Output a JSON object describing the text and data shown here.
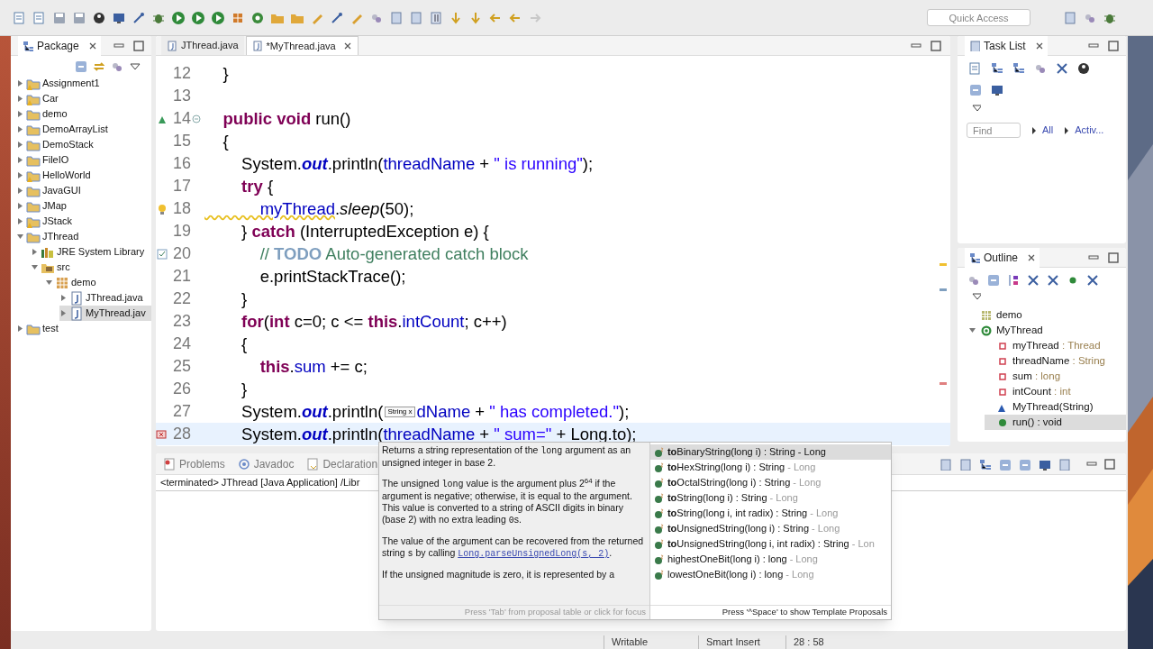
{
  "toolbar": {
    "quick_access": {
      "placeholder": "Quick Access"
    }
  },
  "package_explorer": {
    "title": "Package",
    "items": [
      {
        "label": "Assignment1",
        "kind": "project",
        "warning": true,
        "expanded": false,
        "selected": false
      },
      {
        "label": "Car",
        "kind": "project",
        "warning": true,
        "expanded": false,
        "selected": false
      },
      {
        "label": "demo",
        "kind": "project",
        "warning": false,
        "expanded": false,
        "selected": false
      },
      {
        "label": "DemoArrayList",
        "kind": "project",
        "warning": false,
        "expanded": false,
        "selected": false
      },
      {
        "label": "DemoStack",
        "kind": "project",
        "warning": false,
        "expanded": false,
        "selected": false
      },
      {
        "label": "FileIO",
        "kind": "project",
        "warning": false,
        "expanded": false,
        "selected": false
      },
      {
        "label": "HelloWorld",
        "kind": "project",
        "warning": true,
        "expanded": false,
        "selected": false
      },
      {
        "label": "JavaGUI",
        "kind": "project",
        "warning": false,
        "expanded": false,
        "selected": false
      },
      {
        "label": "JMap",
        "kind": "project",
        "warning": false,
        "expanded": false,
        "selected": false
      },
      {
        "label": "JStack",
        "kind": "project",
        "warning": true,
        "expanded": false,
        "selected": false
      },
      {
        "label": "JThread",
        "kind": "project",
        "warning": false,
        "expanded": true,
        "selected": false,
        "children": [
          {
            "label": "JRE System Library",
            "kind": "library",
            "warning": false,
            "expanded": false,
            "selected": false
          },
          {
            "label": "src",
            "kind": "source_folder",
            "warning": false,
            "expanded": true,
            "selected": false,
            "children": [
              {
                "label": "demo",
                "kind": "package",
                "warning": false,
                "expanded": true,
                "selected": false,
                "children": [
                  {
                    "label": "JThread.java",
                    "kind": "java_file",
                    "warning": false,
                    "expanded": false,
                    "selected": false
                  },
                  {
                    "label": "MyThread.jav",
                    "kind": "java_file",
                    "warning": false,
                    "expanded": false,
                    "selected": true
                  }
                ]
              }
            ]
          }
        ]
      },
      {
        "label": "test",
        "kind": "project",
        "warning": false,
        "expanded": false,
        "selected": false
      }
    ]
  },
  "editor": {
    "tabs": [
      {
        "label": "JThread.java",
        "selected": false
      },
      {
        "label": "*MyThread.java",
        "selected": true
      }
    ],
    "lines": [
      {
        "number": "12",
        "kind": "plain",
        "current": false,
        "tokens": [
          {
            "text": "    }",
            "kind": "plain"
          }
        ]
      },
      {
        "number": "13",
        "kind": "plain",
        "current": false
      },
      {
        "number": "14",
        "kind": "override",
        "current": false,
        "tokens": [
          {
            "text": "    public void",
            "kind": "keyword"
          },
          {
            "text": " run()",
            "kind": "plain"
          }
        ]
      },
      {
        "number": "15",
        "kind": "plain",
        "current": false,
        "tokens": [
          {
            "text": "    {",
            "kind": "plain"
          }
        ]
      },
      {
        "number": "16",
        "kind": "plain",
        "current": false,
        "tokens": [
          {
            "text": "        System.",
            "kind": "plain"
          },
          {
            "text": "out",
            "kind": "static_field"
          },
          {
            "text": ".println(",
            "kind": "plain"
          },
          {
            "text": "threadName",
            "kind": "field"
          },
          {
            "text": " + ",
            "kind": "plain"
          },
          {
            "text": "\" is running\"",
            "kind": "string"
          },
          {
            "text": ");",
            "kind": "plain"
          }
        ]
      },
      {
        "number": "17",
        "kind": "plain",
        "current": false,
        "tokens": [
          {
            "text": "        try",
            "kind": "keyword"
          },
          {
            "text": " {",
            "kind": "plain"
          }
        ]
      },
      {
        "number": "18",
        "kind": "warning",
        "current": false,
        "tokens": [
          {
            "text": "            myThread",
            "kind": "field_warning"
          },
          {
            "text": ".",
            "kind": "plain"
          },
          {
            "text": "sleep",
            "kind": "static_method"
          },
          {
            "text": "(50);",
            "kind": "plain"
          }
        ]
      },
      {
        "number": "19",
        "kind": "plain",
        "current": false,
        "tokens": [
          {
            "text": "        } ",
            "kind": "plain"
          },
          {
            "text": "catch",
            "kind": "keyword"
          },
          {
            "text": " (InterruptedException e) {",
            "kind": "plain"
          }
        ]
      },
      {
        "number": "20",
        "kind": "task",
        "current": false,
        "tokens": [
          {
            "text": "            // ",
            "kind": "comment"
          },
          {
            "text": "TODO",
            "kind": "task_tag"
          },
          {
            "text": " Auto-generated catch block",
            "kind": "comment"
          }
        ]
      },
      {
        "number": "21",
        "kind": "plain",
        "current": false,
        "tokens": [
          {
            "text": "            e.printStackTrace();",
            "kind": "plain"
          }
        ]
      },
      {
        "number": "22",
        "kind": "plain",
        "current": false,
        "tokens": [
          {
            "text": "        }",
            "kind": "plain"
          }
        ]
      },
      {
        "number": "23",
        "kind": "plain",
        "current": false,
        "tokens": [
          {
            "text": "        for",
            "kind": "keyword"
          },
          {
            "text": "(",
            "kind": "plain"
          },
          {
            "text": "int",
            "kind": "keyword"
          },
          {
            "text": " c=0; c <= ",
            "kind": "plain"
          },
          {
            "text": "this",
            "kind": "keyword"
          },
          {
            "text": ".",
            "kind": "plain"
          },
          {
            "text": "intCount",
            "kind": "field"
          },
          {
            "text": "; c++)",
            "kind": "plain"
          }
        ]
      },
      {
        "number": "24",
        "kind": "plain",
        "current": false,
        "tokens": [
          {
            "text": "        {",
            "kind": "plain"
          }
        ]
      },
      {
        "number": "25",
        "kind": "plain",
        "current": false,
        "tokens": [
          {
            "text": "            this",
            "kind": "keyword"
          },
          {
            "text": ".",
            "kind": "plain"
          },
          {
            "text": "sum",
            "kind": "field"
          },
          {
            "text": " += c;",
            "kind": "plain"
          }
        ]
      },
      {
        "number": "26",
        "kind": "plain",
        "current": false,
        "tokens": [
          {
            "text": "        }",
            "kind": "plain"
          }
        ]
      },
      {
        "number": "27",
        "kind": "plain",
        "current": false,
        "tokens": [
          {
            "text": "        System.",
            "kind": "plain"
          },
          {
            "text": "out",
            "kind": "static_field"
          },
          {
            "text": ".println(",
            "kind": "plain"
          },
          {
            "text": "String x",
            "kind": "hint"
          },
          {
            "text": "dName",
            "kind": "field"
          },
          {
            "text": " + ",
            "kind": "plain"
          },
          {
            "text": "\" has completed.\"",
            "kind": "string"
          },
          {
            "text": ");",
            "kind": "plain"
          }
        ]
      },
      {
        "number": "28",
        "kind": "error",
        "current": true,
        "tokens": [
          {
            "text": "        System.",
            "kind": "plain"
          },
          {
            "text": "out",
            "kind": "static_field"
          },
          {
            "text": ".println(",
            "kind": "plain"
          },
          {
            "text": "threadName",
            "kind": "field"
          },
          {
            "text": " + ",
            "kind": "plain"
          },
          {
            "text": "\" sum=\"",
            "kind": "string"
          },
          {
            "text": " + Long.to);",
            "kind": "plain"
          }
        ]
      }
    ]
  },
  "completion": {
    "doc": [
      [
        {
          "text": "Returns a string representation of the ",
          "kind": "text"
        },
        {
          "text": "long",
          "kind": "code"
        },
        {
          "text": " argument as an unsigned integer in base 2.",
          "kind": "text"
        }
      ],
      [
        {
          "text": "The unsigned ",
          "kind": "text"
        },
        {
          "text": "long",
          "kind": "code"
        },
        {
          "text": " value is the argument plus 2$^{64}$ if the argument is negative; otherwise, it is equal to the argument. This value is converted to a string of ASCII digits in binary (base 2) with no extra leading ",
          "kind": "text"
        },
        {
          "text": "0",
          "kind": "code"
        },
        {
          "text": "s.",
          "kind": "text"
        }
      ],
      [
        {
          "text": "The value of the argument can be recovered from the returned string ",
          "kind": "text"
        },
        {
          "text": "s",
          "kind": "code"
        },
        {
          "text": " by calling ",
          "kind": "text"
        },
        {
          "text": "Long.parseUnsignedLong(s, 2)",
          "kind": "link"
        },
        {
          "text": ".",
          "kind": "text"
        }
      ],
      [
        {
          "text": "If the unsigned magnitude is zero, it is represented by a",
          "kind": "text"
        }
      ]
    ],
    "doc_footer": "Press 'Tab' from proposal table or click for focus",
    "proposals": [
      {
        "label": "**to**BinaryString(long i) : String",
        "qualifier": "- Long",
        "selected": true
      },
      {
        "label": "**to**HexString(long i) : String",
        "qualifier": "- Long",
        "selected": false
      },
      {
        "label": "**to**OctalString(long i) : String",
        "qualifier": "- Long",
        "selected": false
      },
      {
        "label": "**to**String(long i) : String",
        "qualifier": "- Long",
        "selected": false
      },
      {
        "label": "**to**String(long i, int radix) : String",
        "qualifier": "- Long",
        "selected": false
      },
      {
        "label": "**to**UnsignedString(long i) : String",
        "qualifier": "- Long",
        "selected": false
      },
      {
        "label": "**to**UnsignedString(long i, int radix) : String",
        "qualifier": "- Lon",
        "selected": false
      },
      {
        "label": "highestOneBit(long i) : long",
        "qualifier": "- Long",
        "selected": false
      },
      {
        "label": "lowestOneBit(long i) : long",
        "qualifier": "- Long",
        "selected": false
      }
    ],
    "list_footer": "Press '^Space' to show Template Proposals"
  },
  "task_list": {
    "title": "Task List",
    "find": {
      "placeholder": "Find"
    },
    "links": [
      "All",
      "Activ..."
    ]
  },
  "outline": {
    "title": "Outline",
    "items": [
      {
        "label": "demo",
        "kind": "package",
        "selected": false
      },
      {
        "label": "MyThread",
        "kind": "class",
        "expanded": true,
        "selected": false,
        "children": [
          {
            "label": "myThread",
            "type": ": Thread",
            "kind": "field",
            "selected": false
          },
          {
            "label": "threadName",
            "type": ": String",
            "kind": "field",
            "selected": false
          },
          {
            "label": "sum",
            "type": ": long",
            "kind": "field",
            "selected": false
          },
          {
            "label": "intCount",
            "type": ": int",
            "kind": "field",
            "selected": false
          },
          {
            "label": "MyThread(String)",
            "kind": "constructor",
            "selected": false
          },
          {
            "label": "run() : void",
            "kind": "method",
            "selected": true
          }
        ]
      }
    ]
  },
  "bottom": {
    "tabs": [
      "Problems",
      "Javadoc",
      "Declaration"
    ],
    "console": "<terminated> JThread [Java Application] /Libr"
  },
  "status_bar": [
    "Writable",
    "Smart Insert",
    "28 : 58"
  ]
}
